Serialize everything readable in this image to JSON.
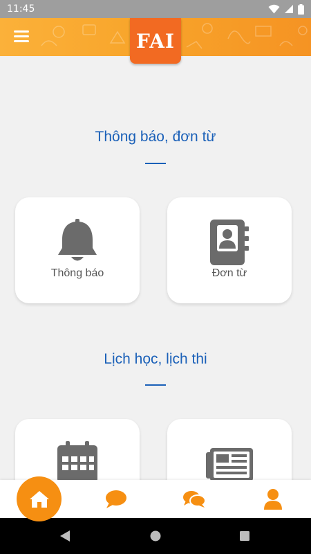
{
  "status_bar": {
    "time": "11:45",
    "icons": [
      "wifi-icon",
      "signal-icon",
      "battery-icon"
    ]
  },
  "header": {
    "logo_text": "FAI",
    "menu_icon": "hamburger-menu-icon"
  },
  "sections": [
    {
      "title": "Thông báo, đơn từ",
      "cards": [
        {
          "label": "Thông báo",
          "icon": "bell-icon"
        },
        {
          "label": "Đơn từ",
          "icon": "contact-book-icon"
        }
      ]
    },
    {
      "title": "Lịch học, lịch thi",
      "cards": [
        {
          "label": "",
          "icon": "calendar-icon"
        },
        {
          "label": "",
          "icon": "newspaper-icon"
        }
      ]
    }
  ],
  "bottom_nav": [
    {
      "icon": "home-icon",
      "active": true
    },
    {
      "icon": "chat-bubble-icon",
      "active": false
    },
    {
      "icon": "conversation-icon",
      "active": false
    },
    {
      "icon": "user-profile-icon",
      "active": false
    }
  ],
  "system_nav": [
    "back-icon",
    "home-circle-icon",
    "recents-icon"
  ],
  "colors": {
    "accent_orange": "#f68f12",
    "title_blue": "#1a60b8",
    "icon_gray": "#6b6b6b",
    "background": "#f1f1f1"
  }
}
